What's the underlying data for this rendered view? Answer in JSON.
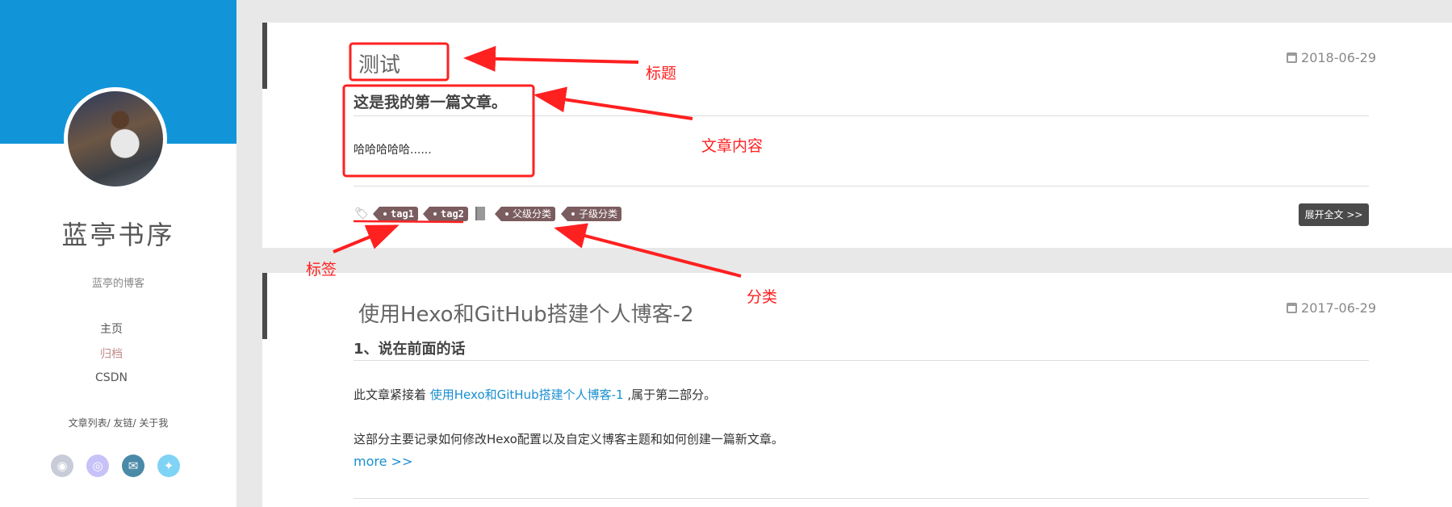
{
  "sidebar": {
    "site_name": "蓝亭书序",
    "subtitle": "蓝亭的博客",
    "nav": [
      "主页",
      "归档",
      "CSDN"
    ],
    "links": "文章列表/ 友链/ 关于我",
    "social": [
      "github-icon",
      "weibo-icon",
      "mail-icon",
      "twitter-icon"
    ],
    "banner_color": "#1195d8"
  },
  "posts": [
    {
      "title": "测试",
      "date": "2018-06-29",
      "heading": "这是我的第一篇文章。",
      "excerpt": "哈哈哈哈哈......",
      "tags": [
        "tag1",
        "tag2"
      ],
      "categories": [
        "父级分类",
        "子级分类"
      ],
      "read_more": "展开全文 >>"
    },
    {
      "title": "使用Hexo和GitHub搭建个人博客-2",
      "date": "2017-06-29",
      "heading": "1、说在前面的话",
      "p1_pre": "此文章紧接着 ",
      "p1_link": "使用Hexo和GitHub搭建个人博客-1",
      "p1_post": " ,属于第二部分。",
      "p2": "这部分主要记录如何修改Hexo配置以及自定义博客主题和如何创建一篇新文章。",
      "more": "more >>"
    }
  ],
  "annotations": {
    "title": "标题",
    "content": "文章内容",
    "tags": "标签",
    "categories": "分类",
    "color": "#ff2020"
  }
}
